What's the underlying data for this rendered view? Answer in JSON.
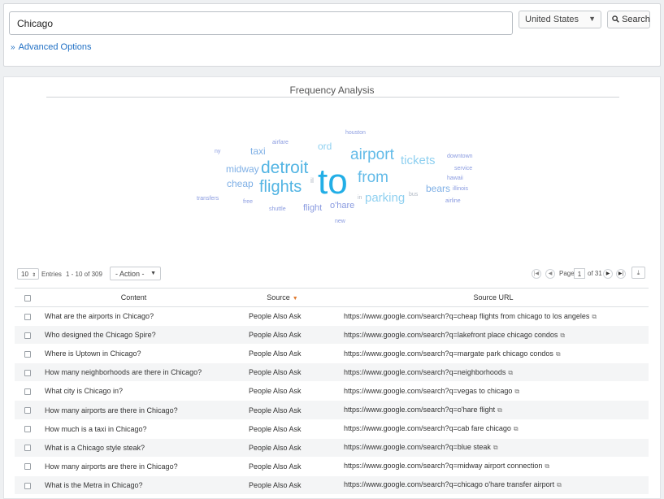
{
  "search": {
    "query": "Chicago",
    "country": "United States",
    "search_label": "Search",
    "advanced_label": "Advanced Options"
  },
  "freq": {
    "title": "Frequency Analysis",
    "words": [
      {
        "text": "to",
        "size": 44,
        "color": "#22aee6",
        "weight": 1.0
      },
      {
        "text": "detroit",
        "size": 21,
        "color": "#52b4e3"
      },
      {
        "text": "flights",
        "size": 20,
        "color": "#52b4e3"
      },
      {
        "text": "airport",
        "size": 19,
        "color": "#63bbe8"
      },
      {
        "text": "from",
        "size": 19,
        "color": "#63bbe8"
      },
      {
        "text": "tickets",
        "size": 15,
        "color": "#8fd0f0"
      },
      {
        "text": "parking",
        "size": 15,
        "color": "#8fd0f0"
      },
      {
        "text": "midway",
        "size": 12,
        "color": "#7fb0e6"
      },
      {
        "text": "cheap",
        "size": 12,
        "color": "#7fb0e6"
      },
      {
        "text": "taxi",
        "size": 12,
        "color": "#7fb0e6"
      },
      {
        "text": "ord",
        "size": 12,
        "color": "#8fd0f0"
      },
      {
        "text": "bears",
        "size": 12,
        "color": "#7fb0e6"
      },
      {
        "text": "flight",
        "size": 11,
        "color": "#8a9be0"
      },
      {
        "text": "o'hare",
        "size": 11,
        "color": "#8a9be0"
      },
      {
        "text": "il",
        "size": 9,
        "color": "#b0b8c4"
      },
      {
        "text": "in",
        "size": 7,
        "color": "#b0b8c4"
      },
      {
        "text": "bus",
        "size": 7,
        "color": "#b0b8c4"
      },
      {
        "text": "houston",
        "size": 7,
        "color": "#8a9be0"
      },
      {
        "text": "airfare",
        "size": 7,
        "color": "#8a9be0"
      },
      {
        "text": "ny",
        "size": 7,
        "color": "#8a9be0"
      },
      {
        "text": "downtown",
        "size": 7,
        "color": "#8a9be0"
      },
      {
        "text": "service",
        "size": 7,
        "color": "#8a9be0"
      },
      {
        "text": "hawaii",
        "size": 7,
        "color": "#8a9be0"
      },
      {
        "text": "illinois",
        "size": 7,
        "color": "#8a9be0"
      },
      {
        "text": "airline",
        "size": 7,
        "color": "#8a9be0"
      },
      {
        "text": "transfers",
        "size": 7,
        "color": "#8a9be0"
      },
      {
        "text": "free",
        "size": 7,
        "color": "#8a9be0"
      },
      {
        "text": "shuttle",
        "size": 7,
        "color": "#8a9be0"
      },
      {
        "text": "new",
        "size": 7,
        "color": "#8a9be0"
      }
    ]
  },
  "toolbar": {
    "entries_count": "10",
    "entries_label": "Entries",
    "range": "1 - 10 of 309",
    "action": "- Action -",
    "page_label": "Page",
    "page_value": "1",
    "of_pages": "of 31"
  },
  "table": {
    "headers": {
      "content": "Content",
      "source": "Source",
      "url": "Source URL"
    },
    "rows": [
      {
        "content": "What are the airports in Chicago?",
        "source": "People Also Ask",
        "url": "https://www.google.com/search?q=cheap flights from chicago to los angeles"
      },
      {
        "content": "Who designed the Chicago Spire?",
        "source": "People Also Ask",
        "url": "https://www.google.com/search?q=lakefront place chicago condos"
      },
      {
        "content": "Where is Uptown in Chicago?",
        "source": "People Also Ask",
        "url": "https://www.google.com/search?q=margate park chicago condos"
      },
      {
        "content": "How many neighborhoods are there in Chicago?",
        "source": "People Also Ask",
        "url": "https://www.google.com/search?q=neighborhoods"
      },
      {
        "content": "What city is Chicago in?",
        "source": "People Also Ask",
        "url": "https://www.google.com/search?q=vegas to chicago"
      },
      {
        "content": "How many airports are there in Chicago?",
        "source": "People Also Ask",
        "url": "https://www.google.com/search?q=o'hare flight"
      },
      {
        "content": "How much is a taxi in Chicago?",
        "source": "People Also Ask",
        "url": "https://www.google.com/search?q=cab fare chicago"
      },
      {
        "content": "What is a Chicago style steak?",
        "source": "People Also Ask",
        "url": "https://www.google.com/search?q=blue steak"
      },
      {
        "content": "How many airports are there in Chicago?",
        "source": "People Also Ask",
        "url": "https://www.google.com/search?q=midway airport connection"
      },
      {
        "content": "What is the Metra in Chicago?",
        "source": "People Also Ask",
        "url": "https://www.google.com/search?q=chicago o'hare transfer airport"
      }
    ]
  }
}
